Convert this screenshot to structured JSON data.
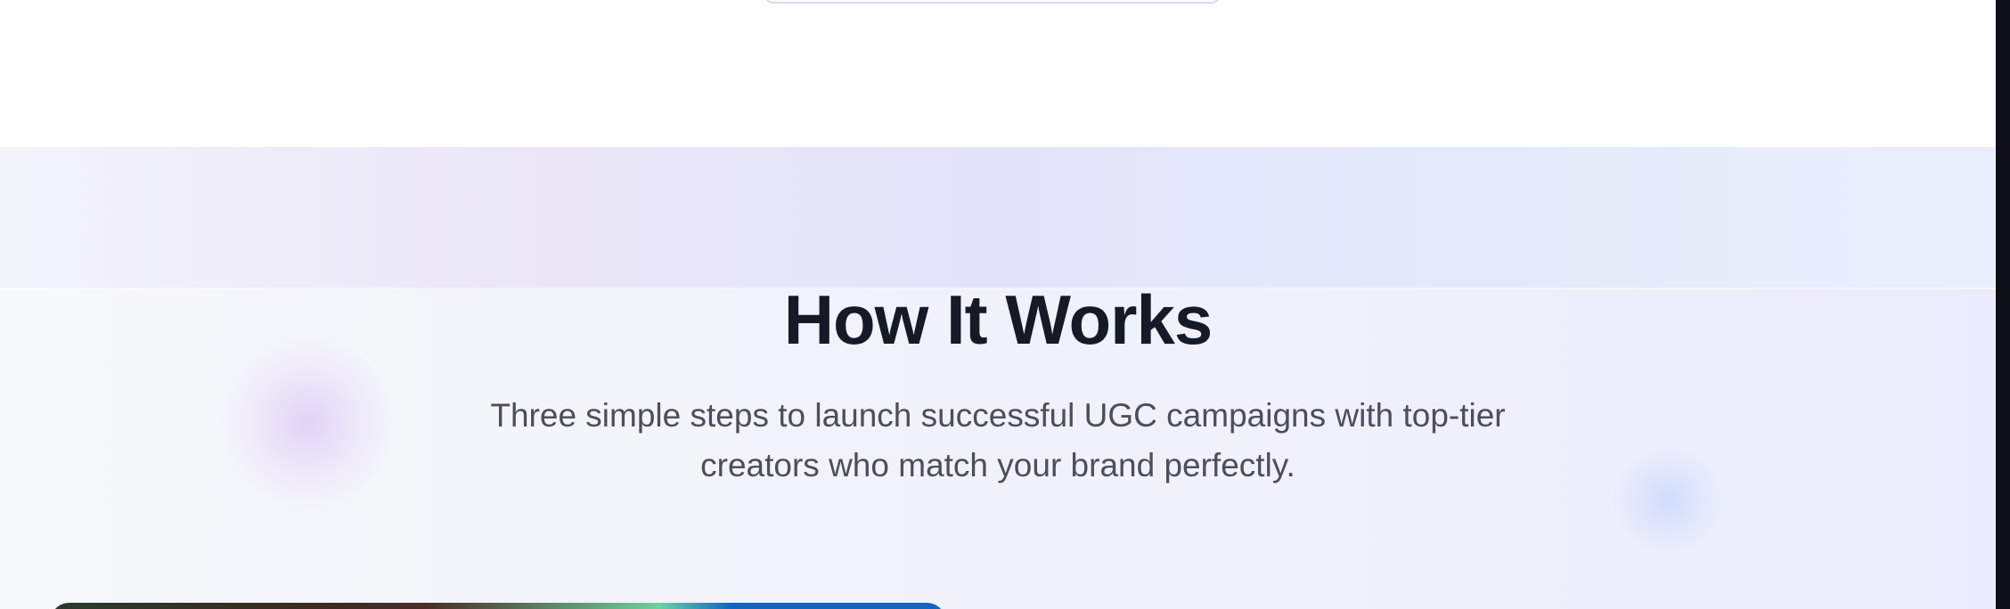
{
  "how_it_works": {
    "title": "How It Works",
    "subtitle": "Three simple steps to launch successful UGC campaigns with top-tier creators who match your brand perfectly."
  }
}
